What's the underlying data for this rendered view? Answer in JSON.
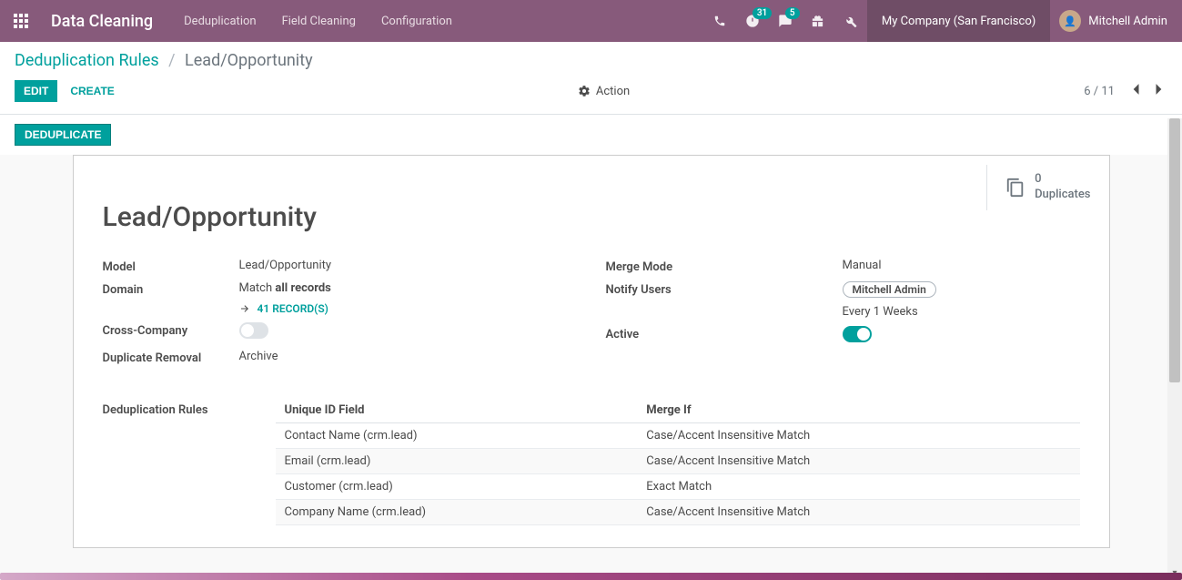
{
  "navbar": {
    "brand": "Data Cleaning",
    "menu": [
      "Deduplication",
      "Field Cleaning",
      "Configuration"
    ],
    "activities_count": "31",
    "messages_count": "5",
    "company": "My Company (San Francisco)",
    "user": "Mitchell Admin"
  },
  "breadcrumb": {
    "parent": "Deduplication Rules",
    "current": "Lead/Opportunity"
  },
  "buttons": {
    "edit": "EDIT",
    "create": "CREATE",
    "action": "Action",
    "deduplicate": "DEDUPLICATE"
  },
  "pager": {
    "position": "6 / 11"
  },
  "stat": {
    "count": "0",
    "label": "Duplicates"
  },
  "record": {
    "title": "Lead/Opportunity",
    "labels": {
      "model": "Model",
      "domain": "Domain",
      "cross_company": "Cross-Company",
      "duplicate_removal": "Duplicate Removal",
      "merge_mode": "Merge Mode",
      "notify_users": "Notify Users",
      "active": "Active",
      "dedup_rules": "Deduplication Rules"
    },
    "model": "Lead/Opportunity",
    "domain_prefix": "Match ",
    "domain_bold": "all records",
    "records_link": "41 RECORD(S)",
    "cross_company": false,
    "duplicate_removal": "Archive",
    "merge_mode": "Manual",
    "notify_users": [
      "Mitchell Admin"
    ],
    "freq_every": "Every",
    "freq_n": "1",
    "freq_unit": "Weeks",
    "active": true
  },
  "rules_table": {
    "headers": {
      "field": "Unique ID Field",
      "merge_if": "Merge If"
    },
    "rows": [
      {
        "field": "Contact Name (crm.lead)",
        "merge_if": "Case/Accent Insensitive Match"
      },
      {
        "field": "Email (crm.lead)",
        "merge_if": "Case/Accent Insensitive Match"
      },
      {
        "field": "Customer (crm.lead)",
        "merge_if": "Exact Match"
      },
      {
        "field": "Company Name (crm.lead)",
        "merge_if": "Case/Accent Insensitive Match"
      }
    ]
  }
}
